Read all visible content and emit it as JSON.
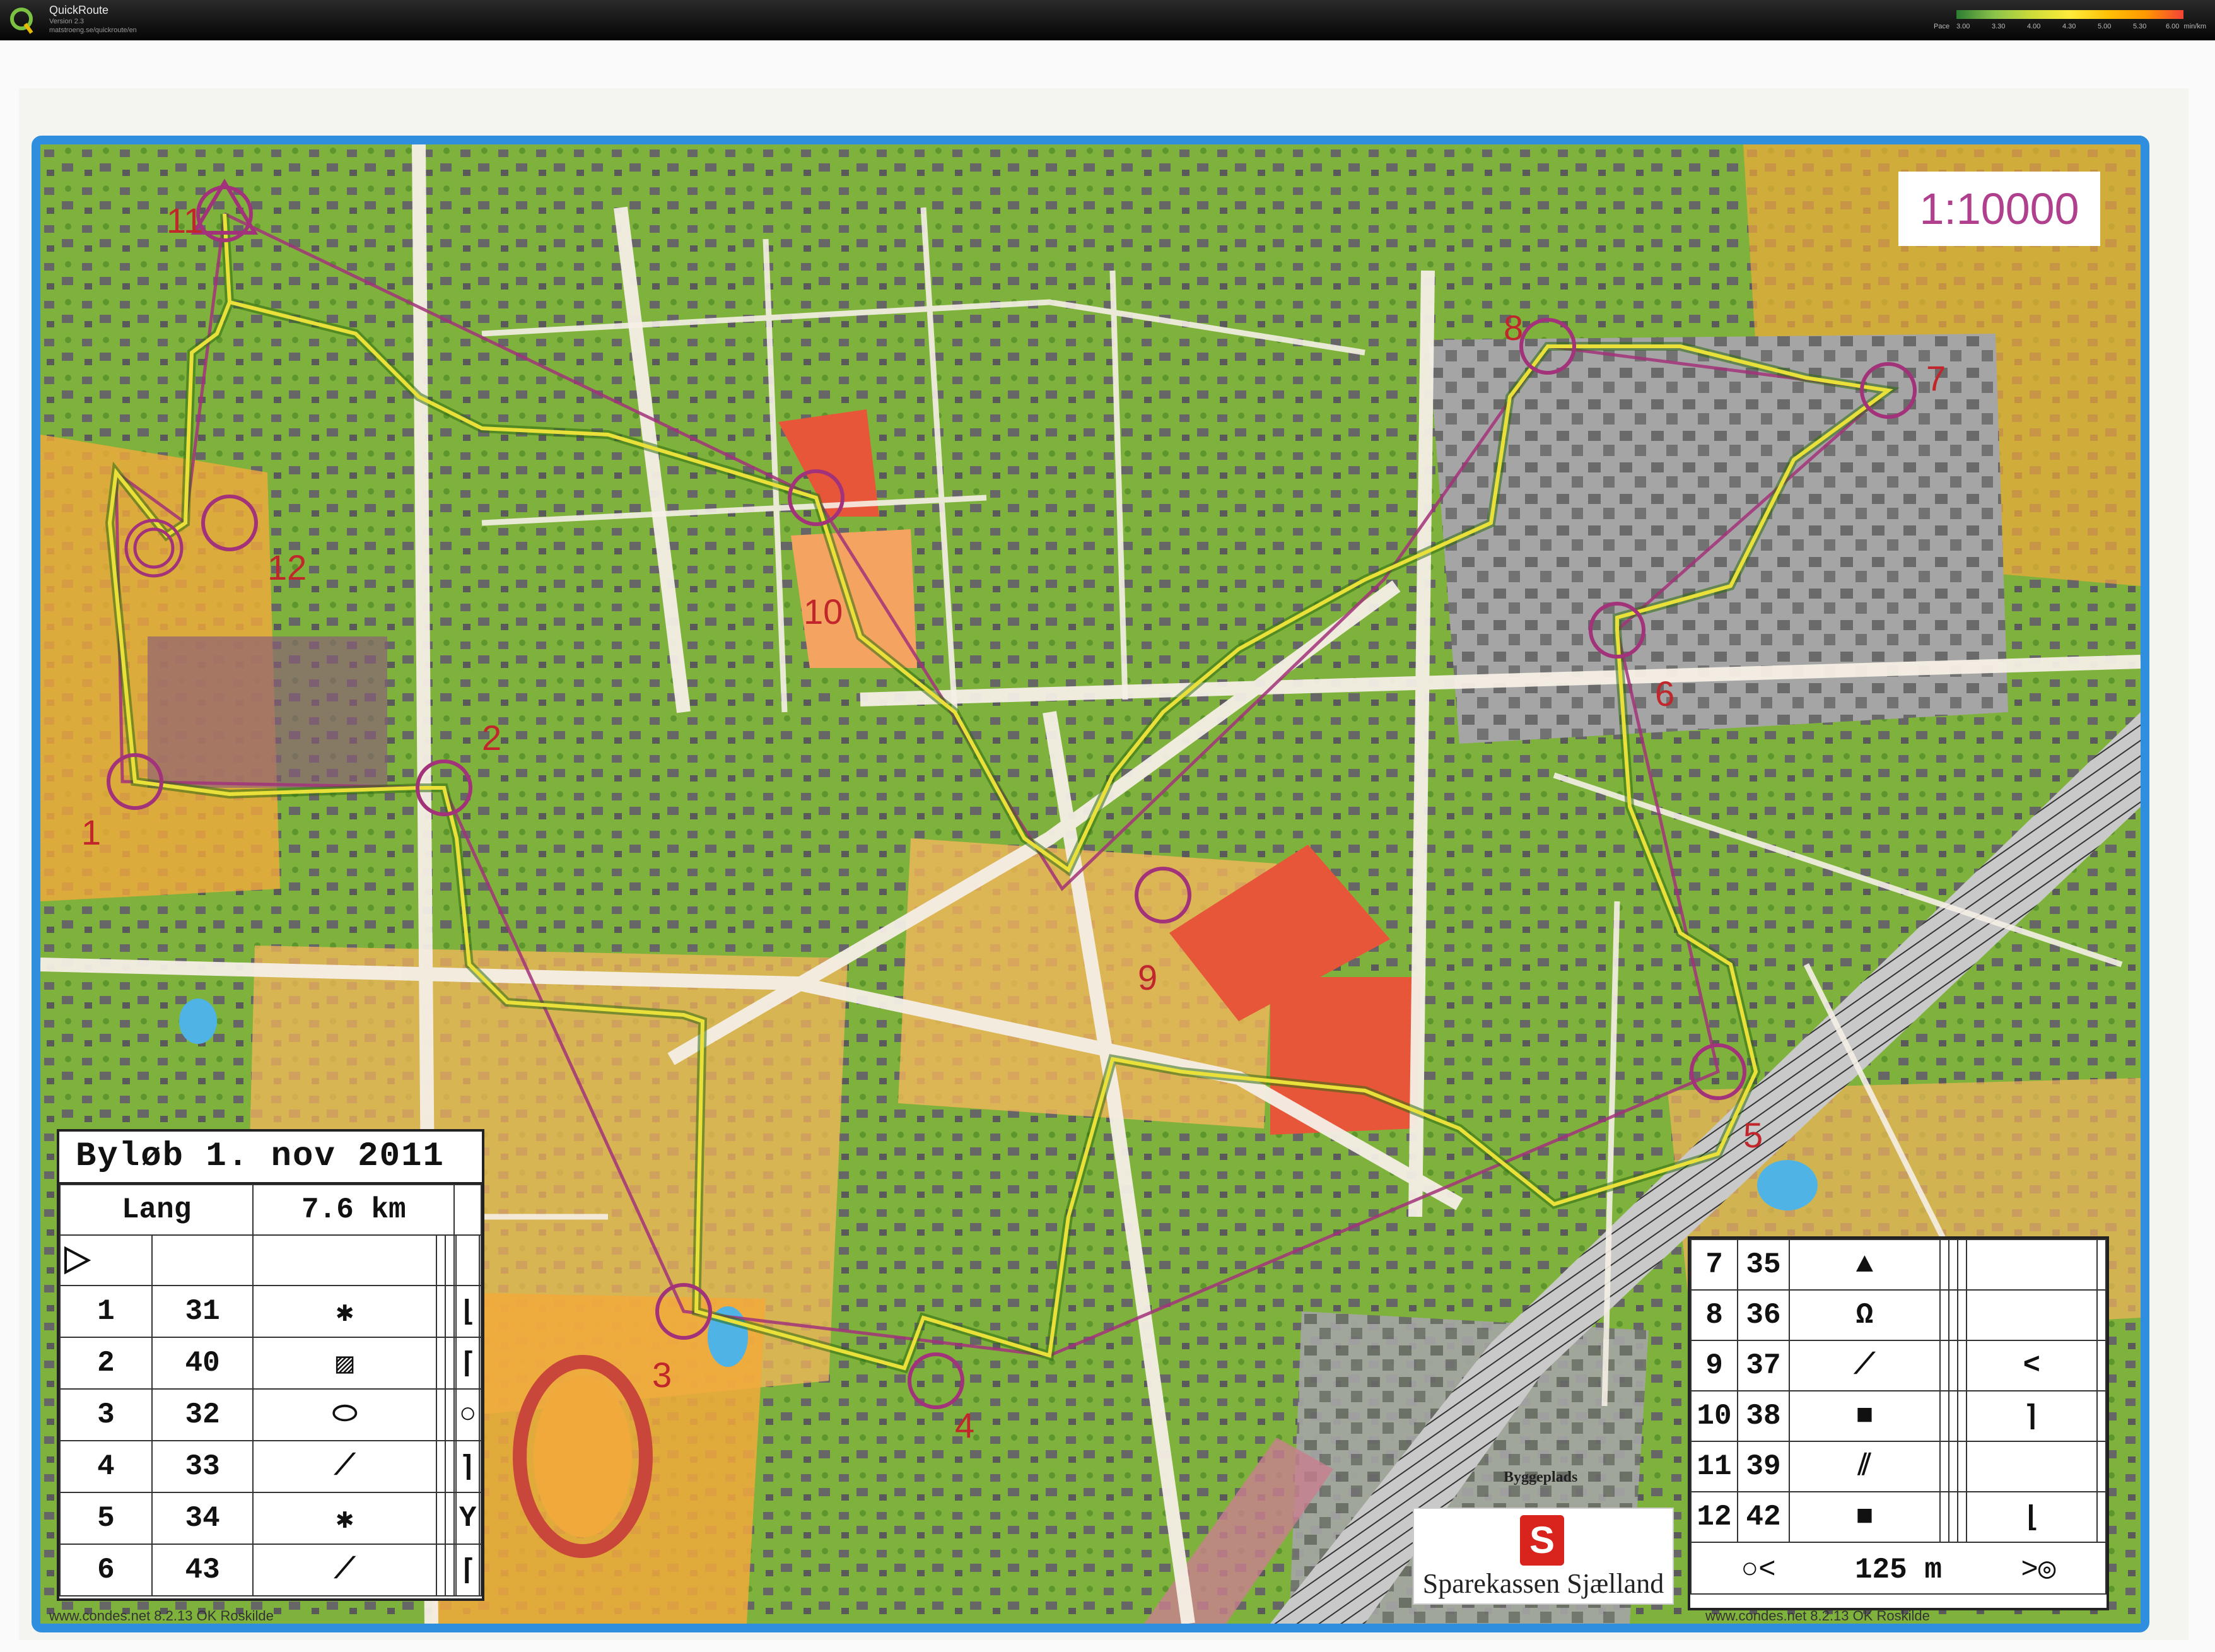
{
  "app": {
    "name": "QuickRoute",
    "version": "Version 2.3",
    "url": "matstroeng.se/quickroute/en"
  },
  "pace_legend": {
    "caption": "Pace",
    "ticks": [
      "3.00",
      "3.30",
      "4.00",
      "4.30",
      "5.00",
      "5.30",
      "6.00"
    ],
    "unit": "min/km"
  },
  "map": {
    "scale": "1:10000",
    "footer_left": "www.condes.net 8.2.13 OK Roskilde",
    "footer_right": "www.condes.net 8.2.13 OK Roskilde",
    "construction_label": "Byggeplads",
    "sponsor": "Sparekassen Sjælland",
    "sponsor_mark": "S",
    "controls": [
      {
        "label": "1"
      },
      {
        "label": "2"
      },
      {
        "label": "3"
      },
      {
        "label": "4"
      },
      {
        "label": "5"
      },
      {
        "label": "6"
      },
      {
        "label": "7"
      },
      {
        "label": "8"
      },
      {
        "label": "9"
      },
      {
        "label": "10"
      },
      {
        "label": "11"
      },
      {
        "label": "12"
      }
    ]
  },
  "description_sheet": {
    "title": "Byløb 1. nov 2011",
    "course": "Lang",
    "length": "7.6 km",
    "rows_left": [
      {
        "num": "1",
        "code": "31"
      },
      {
        "num": "2",
        "code": "40"
      },
      {
        "num": "3",
        "code": "32"
      },
      {
        "num": "4",
        "code": "33"
      },
      {
        "num": "5",
        "code": "34"
      },
      {
        "num": "6",
        "code": "43"
      }
    ],
    "rows_right": [
      {
        "num": "7",
        "code": "35"
      },
      {
        "num": "8",
        "code": "36"
      },
      {
        "num": "9",
        "code": "37"
      },
      {
        "num": "10",
        "code": "38"
      },
      {
        "num": "11",
        "code": "39"
      },
      {
        "num": "12",
        "code": "42"
      }
    ],
    "finish_distance": "125 m"
  }
}
